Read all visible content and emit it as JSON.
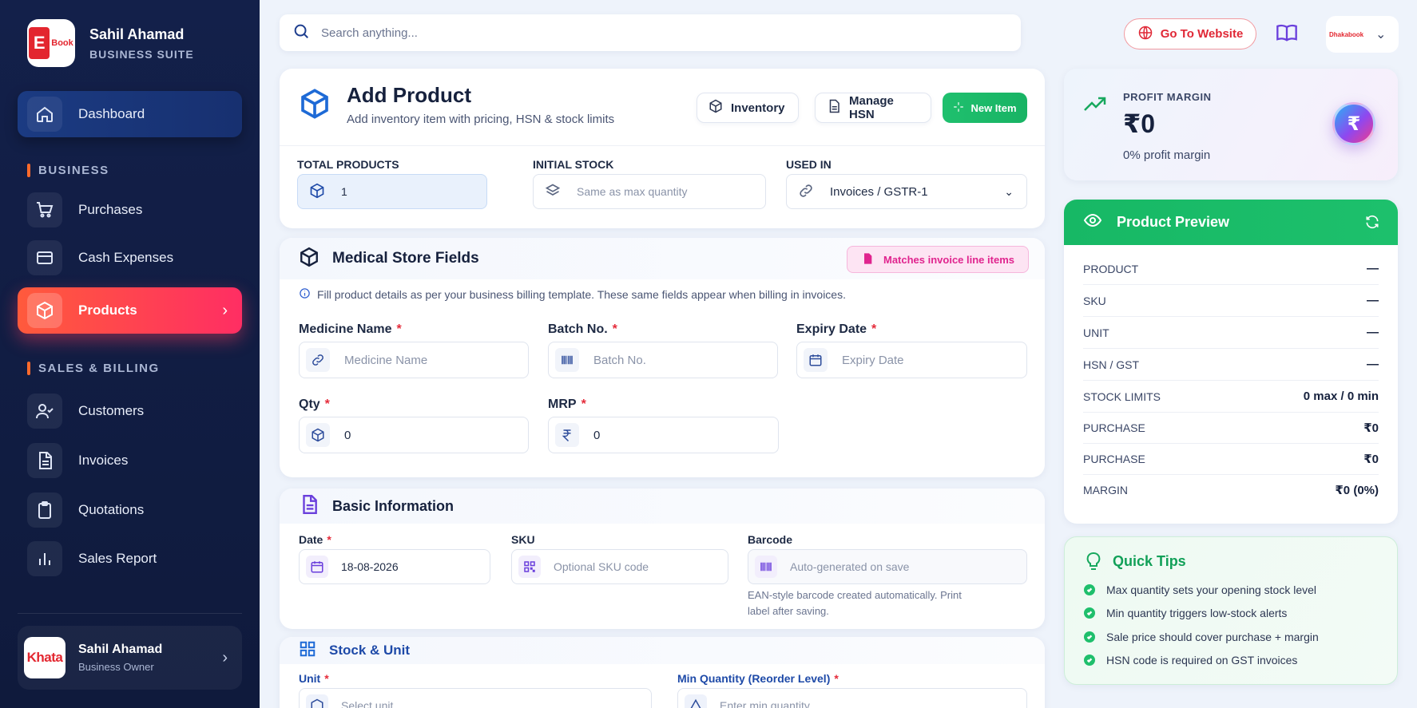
{
  "brand": {
    "name": "Sahil Ahamad",
    "subtitle": "BUSINESS SUITE",
    "logo_text": "Book",
    "logo_letter": "E"
  },
  "nav": {
    "dashboard": "Dashboard",
    "section_business": "BUSINESS",
    "purchases": "Purchases",
    "cash_expenses": "Cash Expenses",
    "products": "Products",
    "section_sales": "SALES & BILLING",
    "customers": "Customers",
    "invoices": "Invoices",
    "quotations": "Quotations",
    "sales_report": "Sales Report"
  },
  "user": {
    "logo_text": "Khata",
    "name": "Sahil Ahamad",
    "role": "Business Owner"
  },
  "topbar": {
    "search_placeholder": "Search anything...",
    "goto_label": "Go To Website",
    "profile_logo_text": "Dhakabook"
  },
  "header": {
    "title": "Add Product",
    "subtitle": "Add inventory item with pricing, HSN & stock limits",
    "btn_inventory": "Inventory",
    "btn_hsn": "Manage HSN",
    "btn_new": "New Item",
    "total_products_label": "TOTAL PRODUCTS",
    "total_products_value": "1",
    "initial_stock_label": "INITIAL STOCK",
    "initial_stock_placeholder": "Same as max quantity",
    "used_in_label": "USED IN",
    "used_in_value": "Invoices / GSTR-1"
  },
  "medical": {
    "title": "Medical Store Fields",
    "badge": "Matches invoice line items",
    "info": "Fill product details as per your business billing template. These same fields appear when billing in invoices.",
    "medicine_label": "Medicine Name",
    "medicine_placeholder": "Medicine Name",
    "batch_label": "Batch No.",
    "batch_placeholder": "Batch No.",
    "expiry_label": "Expiry Date",
    "expiry_placeholder": "Expiry Date",
    "qty_label": "Qty",
    "qty_value": "0",
    "mrp_label": "MRP",
    "mrp_value": "0",
    "req": "*"
  },
  "basic": {
    "title": "Basic Information",
    "date_label": "Date",
    "date_value": "18-08-2026",
    "sku_label": "SKU",
    "sku_placeholder": "Optional SKU code",
    "barcode_label": "Barcode",
    "barcode_placeholder": "Auto-generated on save",
    "barcode_hint": "EAN-style barcode created automatically. Print label after saving."
  },
  "stock": {
    "title": "Stock & Unit",
    "unit_label": "Unit",
    "unit_placeholder": "Select unit",
    "min_label": "Min Quantity (Reorder Level)",
    "min_placeholder": "Enter min quantity"
  },
  "profit": {
    "label": "PROFIT MARGIN",
    "value": "₹0",
    "sub": "0% profit margin",
    "coin": "₹"
  },
  "preview": {
    "title": "Product Preview",
    "rows": [
      {
        "k": "PRODUCT",
        "v": "—"
      },
      {
        "k": "SKU",
        "v": "—"
      },
      {
        "k": "UNIT",
        "v": "—"
      },
      {
        "k": "HSN / GST",
        "v": "—"
      },
      {
        "k": "STOCK LIMITS",
        "v": "0 max / 0 min"
      },
      {
        "k": "PURCHASE",
        "v": "₹0"
      },
      {
        "k": "PURCHASE",
        "v": "₹0"
      },
      {
        "k": "MARGIN",
        "v": "₹0 (0%)"
      }
    ]
  },
  "tips": {
    "title": "Quick Tips",
    "items": [
      "Max quantity sets your opening stock level",
      "Min quantity triggers low-stock alerts",
      "Sale price should cover purchase + margin",
      "HSN code is required on GST invoices"
    ]
  },
  "colors": {
    "accent_red": "#ff2e63",
    "accent_green": "#1dc06c",
    "sidebar_bg": "#13204a",
    "primary_blue": "#1e6ad6"
  }
}
